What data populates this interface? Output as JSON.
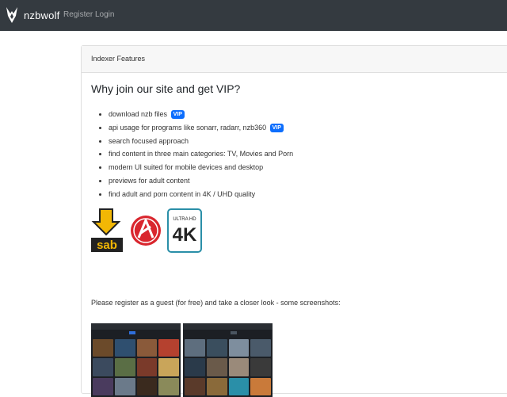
{
  "navbar": {
    "brand": "nzbwolf",
    "links": [
      "Register",
      "Login"
    ]
  },
  "card": {
    "header": "Indexer Features",
    "title": "Why join our site and get VIP?",
    "features": [
      {
        "text": "download nzb files",
        "badge": "VIP"
      },
      {
        "text": "api usage for programs like sonarr, radarr, nzb360",
        "badge": "VIP"
      },
      {
        "text": "search focused approach"
      },
      {
        "text": "find content in three main categories: TV, Movies and Porn"
      },
      {
        "text": "modern UI suited for mobile devices and desktop"
      },
      {
        "text": "previews for adult content"
      },
      {
        "text": "find adult and porn content in 4K / UHD quality"
      }
    ],
    "logos": {
      "sab": "sab",
      "uhd_small": "ULTRA HD",
      "uhd_big": "4K"
    },
    "register_text": "Please register as a guest (for free) and take a closer look - some screenshots:",
    "screenshots": [
      "screenshot-1",
      "screenshot-2"
    ]
  },
  "colors": {
    "navbar": "#343a40",
    "vip_badge": "#0d6efd"
  }
}
